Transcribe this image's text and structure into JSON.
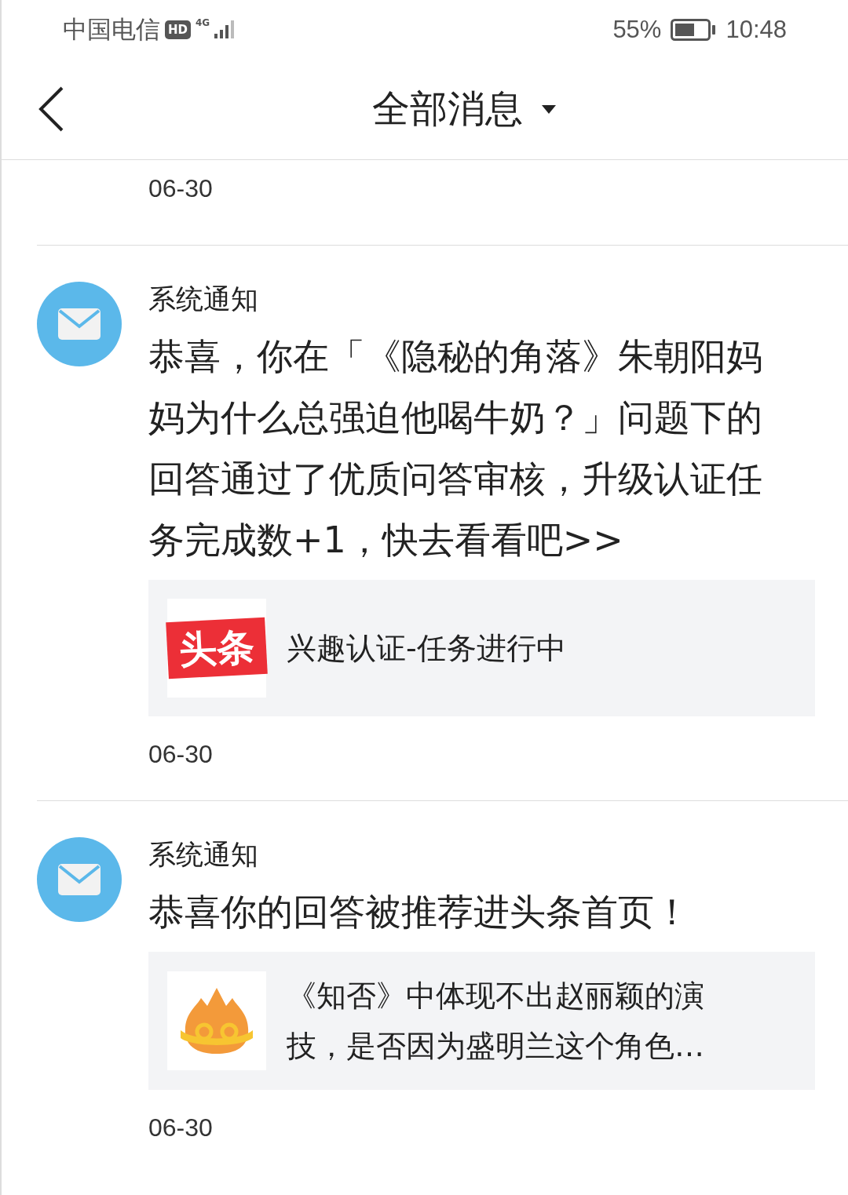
{
  "status_bar": {
    "carrier": "中国电信",
    "hd_badge": "HD",
    "network": "4G",
    "battery_percent": "55%",
    "time": "10:48"
  },
  "header": {
    "title": "全部消息"
  },
  "top_date": "06-30",
  "messages": [
    {
      "sender": "系统通知",
      "body": "恭喜，你在「《隐秘的角落》朱朝阳妈妈为什么总强迫他喝牛奶？」问题下的回答通过了优质问答审核，升级认证任务完成数+1，快去看看吧>>",
      "card": {
        "kind": "logo",
        "logo_text": "头条",
        "text": "兴趣认证-任务进行中"
      },
      "date": "06-30"
    },
    {
      "sender": "系统通知",
      "body": "恭喜你的回答被推荐进头条首页！",
      "card": {
        "kind": "flame",
        "text": "《知否》中体现不出赵丽颖的演技，是否因为盛明兰这个角色…"
      },
      "date": "06-30"
    }
  ]
}
